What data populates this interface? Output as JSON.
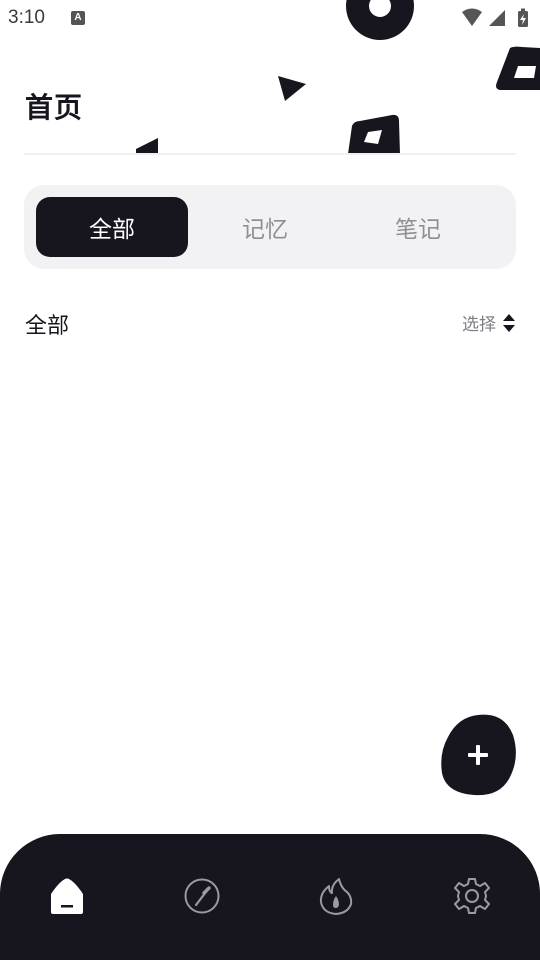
{
  "status_bar": {
    "time": "3:10",
    "notification_icon": "A"
  },
  "header": {
    "title": "首页"
  },
  "tabs": [
    {
      "label": "全部",
      "active": true
    },
    {
      "label": "记忆",
      "active": false
    },
    {
      "label": "笔记",
      "active": false
    }
  ],
  "section": {
    "title": "全部",
    "select_label": "选择"
  },
  "fab": {
    "icon": "plus-icon"
  },
  "bottom_nav": {
    "items": [
      {
        "icon": "home-icon",
        "active": true
      },
      {
        "icon": "compass-icon",
        "active": false
      },
      {
        "icon": "flame-icon",
        "active": false
      },
      {
        "icon": "gear-icon",
        "active": false
      }
    ]
  },
  "colors": {
    "primary": "#17161f",
    "background": "#ffffff",
    "segment_background": "#f2f2f4",
    "muted_text": "#8e8e94"
  }
}
